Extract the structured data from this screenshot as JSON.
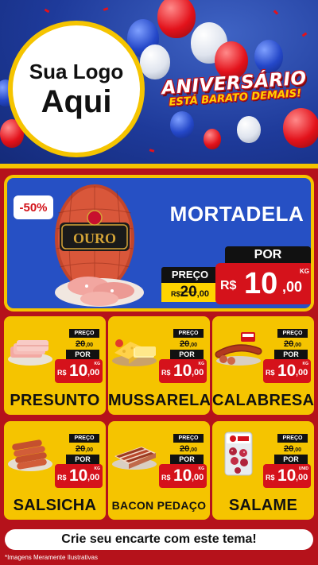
{
  "colors": {
    "accent_red": "#d5121b",
    "accent_yellow": "#f5c400",
    "header_blue": "#1e3a9a",
    "hero_blue": "#2650c4"
  },
  "header": {
    "logo_line1": "Sua Logo",
    "logo_line2": "Aqui",
    "campaign_title": "ANIVERSÁRIO",
    "campaign_subtitle": "ESTÁ BARATO DEMAIS!"
  },
  "hero": {
    "badge": "-50%",
    "name": "MORTADELA",
    "brand_text": "OURO",
    "old_label": "PREÇO",
    "old_currency": "R$",
    "old_int": "20",
    "old_cents": ",00",
    "new_label": "POR",
    "new_currency": "R$",
    "new_int": "10",
    "new_cents": ",00",
    "unit": "KG"
  },
  "products": [
    {
      "name": "PRESUNTO",
      "old_label": "PREÇO",
      "old_int": "20",
      "old_cents": ",00",
      "new_label": "POR",
      "currency": "R$",
      "new_int": "10",
      "new_cents": ",00",
      "unit": "KG",
      "icon": "ham-slices-icon"
    },
    {
      "name": "MUSSARELA",
      "old_label": "PREÇO",
      "old_int": "20",
      "old_cents": ",00",
      "new_label": "POR",
      "currency": "R$",
      "new_int": "10",
      "new_cents": ",00",
      "unit": "KG",
      "icon": "cheese-icon"
    },
    {
      "name": "CALABRESA",
      "old_label": "PREÇO",
      "old_int": "20",
      "old_cents": ",00",
      "new_label": "POR",
      "currency": "R$",
      "new_int": "10",
      "new_cents": ",00",
      "unit": "KG",
      "icon": "sausage-icon"
    },
    {
      "name": "SALSICHA",
      "old_label": "PREÇO",
      "old_int": "20",
      "old_cents": ",00",
      "new_label": "POR",
      "currency": "R$",
      "new_int": "10",
      "new_cents": ",00",
      "unit": "KG",
      "icon": "hotdog-sausage-icon"
    },
    {
      "name": "BACON PEDAÇO",
      "old_label": "PREÇO",
      "old_int": "20",
      "old_cents": ",00",
      "new_label": "POR",
      "currency": "R$",
      "new_int": "10",
      "new_cents": ",00",
      "unit": "KG",
      "icon": "bacon-icon"
    },
    {
      "name": "SALAME",
      "old_label": "PREÇO",
      "old_int": "20",
      "old_cents": ",00",
      "new_label": "POR",
      "currency": "R$",
      "new_int": "10",
      "new_cents": ",00",
      "unit": "UNID",
      "icon": "salami-package-icon"
    }
  ],
  "footer": {
    "cta": "Crie seu encarte com este tema!",
    "disclaimer": "*Imagens Meramente Ilustrativas"
  }
}
